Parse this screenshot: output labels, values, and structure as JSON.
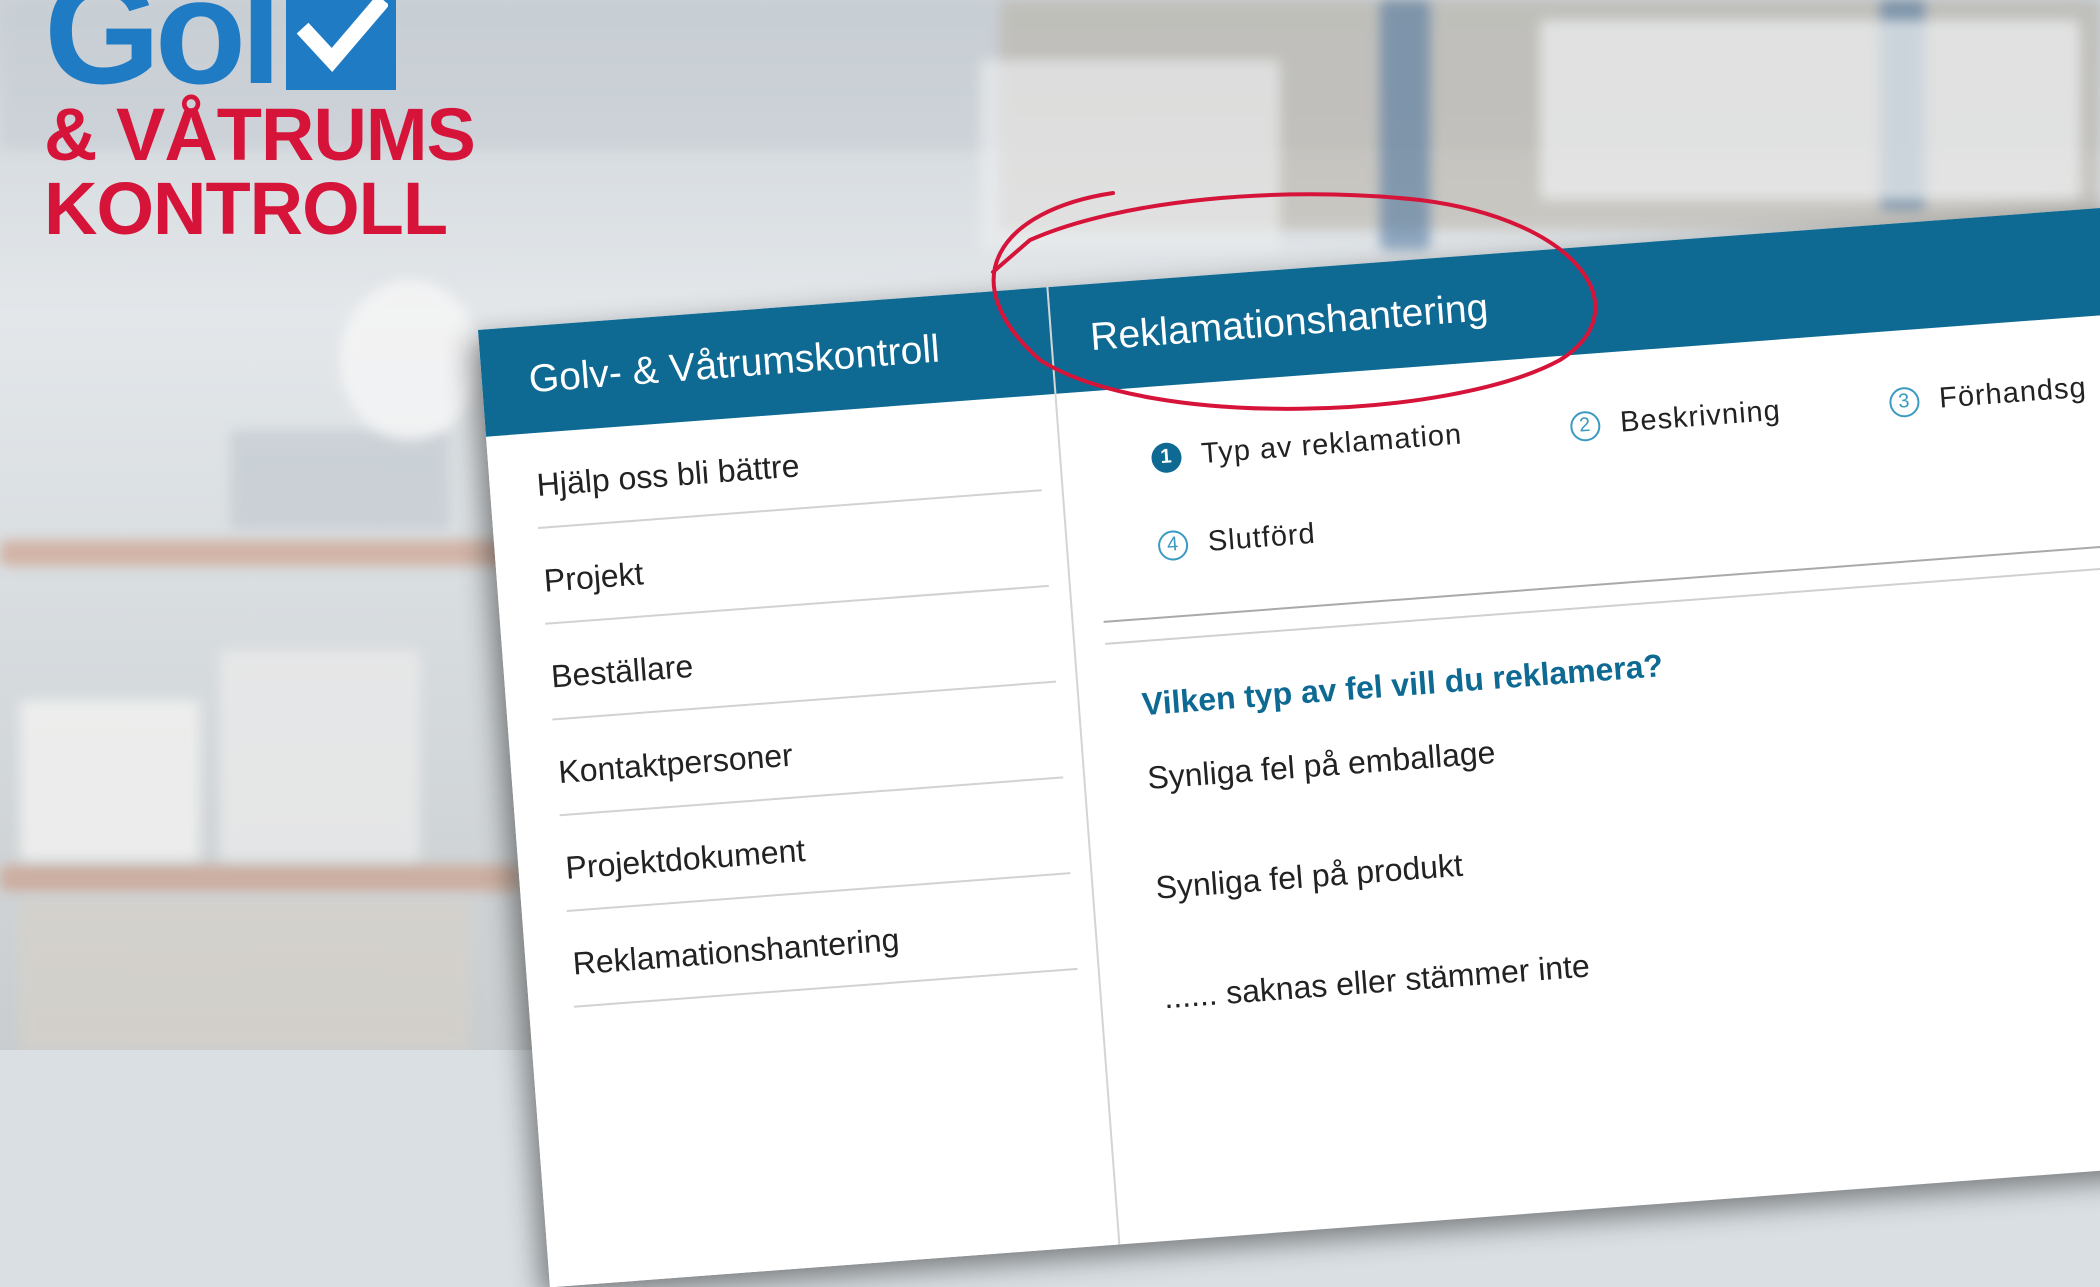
{
  "logo": {
    "word": "Gol",
    "line1": "& VÅTRUMS",
    "line2": "KONTROLL",
    "brand_blue": "#1e7bc4",
    "brand_red": "#d6143a"
  },
  "sidebar": {
    "title": "Golv- & Våtrumskontroll",
    "items": [
      {
        "label": "Hjälp oss bli bättre"
      },
      {
        "label": "Projekt"
      },
      {
        "label": "Beställare"
      },
      {
        "label": "Kontaktpersoner"
      },
      {
        "label": "Projektdokument"
      },
      {
        "label": "Reklamationshantering"
      }
    ]
  },
  "main": {
    "title": "Reklamationshantering",
    "steps": [
      {
        "num": "1",
        "label": "Typ av reklamation",
        "active": true
      },
      {
        "num": "2",
        "label": "Beskrivning",
        "active": false
      },
      {
        "num": "3",
        "label": "Förhandsg",
        "active": false
      },
      {
        "num": "4",
        "label": "Slutförd",
        "active": false
      }
    ],
    "question": "Vilken typ av fel vill du reklamera?",
    "options": [
      {
        "label": "Synliga fel på emballage"
      },
      {
        "label": "Synliga fel på produkt"
      },
      {
        "label": "...... saknas eller stämmer inte"
      }
    ]
  },
  "colors": {
    "header_blue": "#0e6a93",
    "annotation_red": "#d6143a"
  }
}
